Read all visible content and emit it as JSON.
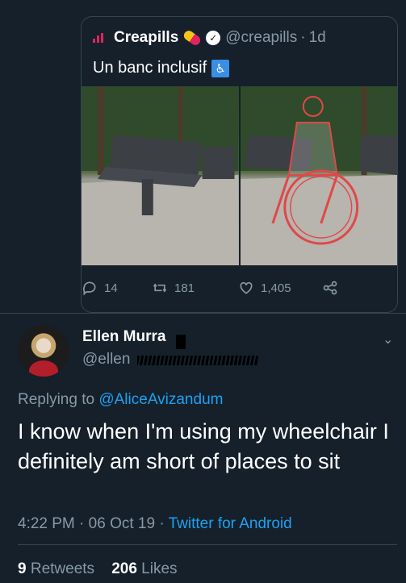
{
  "quoted_tweet": {
    "author_name": "Creapills",
    "handle": "@creapills",
    "separator": "·",
    "time": "1d",
    "text": "Un banc inclusif",
    "icons": [
      "bars-logo-icon",
      "pill-emoji-icon",
      "verified-icon",
      "wheelchair-emoji-icon"
    ],
    "reply_count": "14",
    "retweet_count": "181",
    "like_count": "1,405"
  },
  "tweet": {
    "author_name": "Ellen Murra",
    "handle": "@ellen",
    "replying_prefix": "Replying to",
    "replying_to": "@AliceAvizandum",
    "text": "I know when I'm using my wheelchair I definitely am short of places to sit",
    "time": "4:22 PM",
    "date": "06 Oct 19",
    "separator": "·",
    "source": "Twitter for Android",
    "retweets_count": "9",
    "retweets_label": "Retweets",
    "likes_count": "206",
    "likes_label": "Likes"
  },
  "colors": {
    "background": "#15202b",
    "muted": "#8899a6",
    "accent": "#1da1f2",
    "border": "#38444d"
  }
}
